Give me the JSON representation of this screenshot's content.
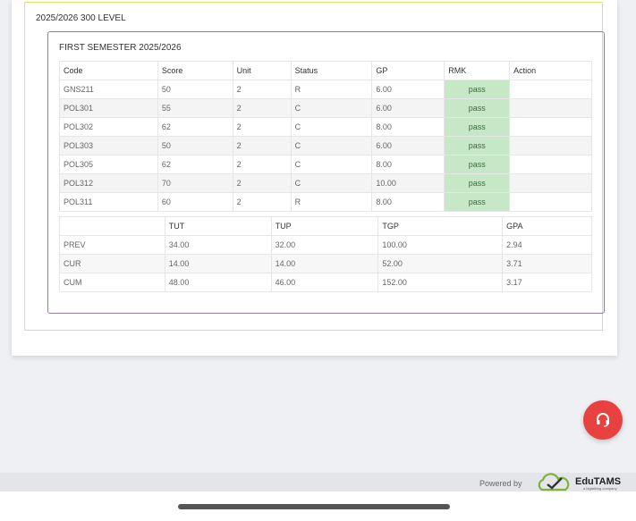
{
  "level": {
    "title": "2025/2026 300 LEVEL"
  },
  "semester": {
    "title": "FIRST SEMESTER 2025/2026",
    "columns": [
      "Code",
      "Score",
      "Unit",
      "Status",
      "GP",
      "RMK",
      "Action"
    ],
    "rows": [
      {
        "code": "GNS211",
        "score": "50",
        "unit": "2",
        "status": "R",
        "gp": "6.00",
        "rmk": "pass",
        "action": ""
      },
      {
        "code": "POL301",
        "score": "55",
        "unit": "2",
        "status": "C",
        "gp": "6.00",
        "rmk": "pass",
        "action": ""
      },
      {
        "code": "POL302",
        "score": "62",
        "unit": "2",
        "status": "C",
        "gp": "8.00",
        "rmk": "pass",
        "action": ""
      },
      {
        "code": "POL303",
        "score": "50",
        "unit": "2",
        "status": "C",
        "gp": "6.00",
        "rmk": "pass",
        "action": ""
      },
      {
        "code": "POL305",
        "score": "62",
        "unit": "2",
        "status": "C",
        "gp": "8.00",
        "rmk": "pass",
        "action": ""
      },
      {
        "code": "POL312",
        "score": "70",
        "unit": "2",
        "status": "C",
        "gp": "10.00",
        "rmk": "pass",
        "action": ""
      },
      {
        "code": "POL311",
        "score": "60",
        "unit": "2",
        "status": "R",
        "gp": "8.00",
        "rmk": "pass",
        "action": ""
      }
    ],
    "rmk_color": "#c6e8c7"
  },
  "summary": {
    "columns": [
      "",
      "TUT",
      "TUP",
      "TGP",
      "GPA"
    ],
    "rows": [
      {
        "label": "PREV",
        "tut": "34.00",
        "tup": "32.00",
        "tgp": "100.00",
        "gpa": "2.94"
      },
      {
        "label": "CUR",
        "tut": "14.00",
        "tup": "14.00",
        "tgp": "52.00",
        "gpa": "3.71"
      },
      {
        "label": "CUM",
        "tut": "48.00",
        "tup": "46.00",
        "tgp": "152.00",
        "gpa": "3.17"
      }
    ]
  },
  "support_button": {
    "icon": "headset-icon",
    "color": "#e94040"
  },
  "footer": {
    "powered_by": "Powered by",
    "brand": "EduTAMS",
    "tagline": "a bigtalking company",
    "logo_icon": "cloud-check-icon"
  }
}
